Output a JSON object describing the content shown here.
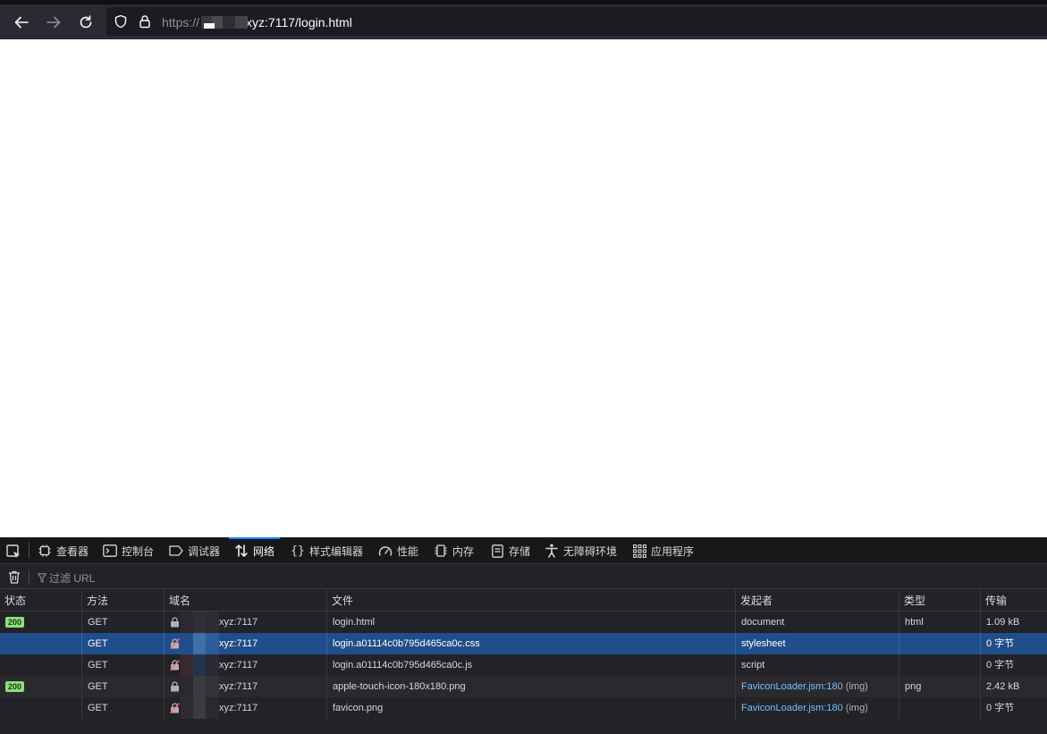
{
  "browser": {
    "url": {
      "scheme": "https://",
      "host_suffix": "xyz:7117/login.html"
    },
    "icons": [
      "back-arrow-icon",
      "forward-arrow-icon",
      "reload-icon",
      "shield-icon",
      "lock-icon"
    ]
  },
  "devtools": {
    "tabs": [
      {
        "label": "查看器",
        "icon": "inspector-icon"
      },
      {
        "label": "控制台",
        "icon": "console-icon"
      },
      {
        "label": "调试器",
        "icon": "debugger-icon"
      },
      {
        "label": "网络",
        "icon": "network-icon",
        "active": true
      },
      {
        "label": "样式编辑器",
        "icon": "style-editor-icon"
      },
      {
        "label": "性能",
        "icon": "performance-icon"
      },
      {
        "label": "内存",
        "icon": "memory-icon"
      },
      {
        "label": "存储",
        "icon": "storage-icon"
      },
      {
        "label": "无障碍环境",
        "icon": "accessibility-icon"
      },
      {
        "label": "应用程序",
        "icon": "application-icon"
      }
    ],
    "filter_placeholder": "过滤 URL",
    "columns": [
      "状态",
      "方法",
      "域名",
      "文件",
      "发起者",
      "类型",
      "传输"
    ],
    "requests": [
      {
        "status": "200",
        "method": "GET",
        "domain": "xyz:7117",
        "file": "login.html",
        "initiator": "document",
        "initiator_type": "",
        "type": "html",
        "transfer": "1.09 kB"
      },
      {
        "status": "",
        "method": "GET",
        "domain": "xyz:7117",
        "file": "login.a01114c0b795d465ca0c.css",
        "initiator": "stylesheet",
        "initiator_type": "",
        "type": "",
        "transfer": "0 字节"
      },
      {
        "status": "",
        "method": "GET",
        "domain": "xyz:7117",
        "file": "login.a01114c0b795d465ca0c.js",
        "initiator": "script",
        "initiator_type": "",
        "type": "",
        "transfer": "0 字节"
      },
      {
        "status": "200",
        "method": "GET",
        "domain": "xyz:7117",
        "file": "apple-touch-icon-180x180.png",
        "initiator": "FaviconLoader.jsm:180",
        "initiator_type": "(img)",
        "type": "png",
        "transfer": "2.42 kB"
      },
      {
        "status": "",
        "method": "GET",
        "domain": "xyz:7117",
        "file": "favicon.png",
        "initiator": "FaviconLoader.jsm:180",
        "initiator_type": "(img)",
        "type": "",
        "transfer": "0 字节"
      }
    ],
    "colors": {
      "accent": "#0a84ff",
      "selected_row": "#204e8a",
      "status_ok": "#8ae07b",
      "link": "#75bfff"
    }
  }
}
